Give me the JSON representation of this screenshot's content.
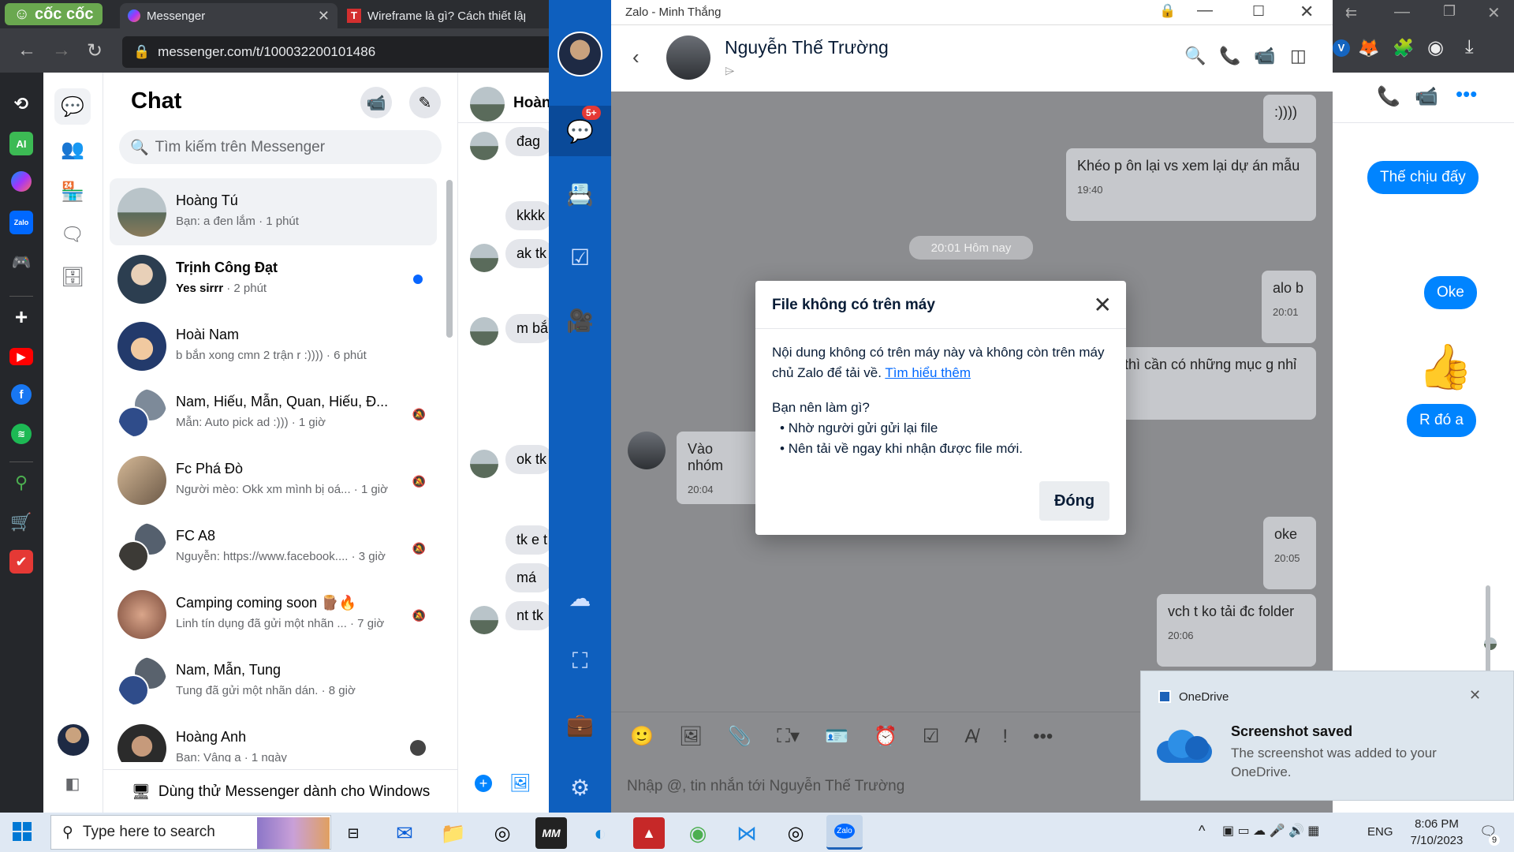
{
  "browser": {
    "brand": "cốc cốc",
    "tabs": [
      {
        "label": "Messenger"
      },
      {
        "label": "Wireframe là gì? Cách thiết lập"
      }
    ],
    "url": "messenger.com/t/100032200101486",
    "ext_badge": "V"
  },
  "rail_labels": {
    "ai": "AI",
    "zalo": "Zalo"
  },
  "messenger": {
    "title": "Chat",
    "search_placeholder": "Tìm kiếm trên Messenger",
    "conversations": [
      {
        "name": "Hoàng Tú",
        "preview": "Bạn: a đen lắm · 1 phút",
        "selected": true
      },
      {
        "name": "Trịnh Công Đạt",
        "preview_bold": "Yes sirrr",
        "preview": " · 2 phút",
        "unread": true
      },
      {
        "name": "Hoài Nam",
        "preview": "b bắn xong cmn 2 trận r :)))) · 6 phút"
      },
      {
        "name": "Nam, Hiếu, Mẫn, Quan, Hiếu, Đ...",
        "preview": "Mẫn: Auto pick ad :))) · 1 giờ",
        "muted": true
      },
      {
        "name": "Fc Phá Đò",
        "preview": "Người mèo: Okk xm mình bị oá... · 1 giờ",
        "muted": true
      },
      {
        "name": "FC A8",
        "preview": "Nguyễn: https://www.facebook.... · 3 giờ",
        "muted": true
      },
      {
        "name": "Camping coming soon 🪵🔥",
        "preview": "Linh tín dụng đã gửi một nhãn ... · 7 giờ",
        "muted": true
      },
      {
        "name": "Nam, Mẫn, Tung",
        "preview": "Tung đã gửi một nhãn dán. · 8 giờ"
      },
      {
        "name": "Hoàng Anh",
        "preview": "Bạn: Vâng a · 1 ngày"
      }
    ],
    "try_windows": "Dùng thử Messenger dành cho Windows",
    "convo_header": "Hoàn",
    "convo_bubbles": [
      "đag",
      "kkkk",
      "ak tk",
      "m bắ",
      "ok tk",
      "tk e t",
      "má",
      "nt tk"
    ],
    "right_bubbles": [
      "Thế chịu đấy",
      "Oke",
      "R đó a"
    ]
  },
  "zalo": {
    "window_title": "Zalo - Minh Thắng",
    "contact_name": "Nguyễn Thế Trường",
    "unread_badge": "5+",
    "messages": [
      {
        "text": ":))))",
        "time": ""
      },
      {
        "text": "Khéo p ôn lại vs xem lại dự án mẫu",
        "time": "19:40"
      },
      {
        "text": "alo b",
        "time": "20:01"
      },
      {
        "text": "thì cần có những mục g nhỉ",
        "time": ""
      },
      {
        "text": "Vào nhóm",
        "time": "20:04"
      },
      {
        "text": "oke",
        "time": "20:05"
      },
      {
        "text": "vch t ko tải đc folder",
        "time": "20:06"
      }
    ],
    "divider": "20:01 Hôm nay",
    "input_placeholder": "Nhập @, tin nhắn tới Nguyễn Thế Trường"
  },
  "dialog": {
    "title": "File không có trên máy",
    "body": "Nội dung không có trên máy này và không còn trên máy chủ Zalo để tải về.",
    "link": "Tìm hiểu thêm",
    "subheading": "Bạn nên làm gì?",
    "bullets": [
      "Nhờ người gửi gửi lại file",
      "Nên tải về ngay khi nhận được file mới."
    ],
    "button": "Đóng"
  },
  "toast": {
    "app": "OneDrive",
    "title": "Screenshot saved",
    "body": "The screenshot was added to your OneDrive."
  },
  "taskbar": {
    "search_placeholder": "Type here to search",
    "lang": "ENG",
    "time": "8:06 PM",
    "date": "7/10/2023",
    "notif_count": "9",
    "app_labels": {
      "mm": "MM",
      "zalo": "Zalo"
    }
  }
}
